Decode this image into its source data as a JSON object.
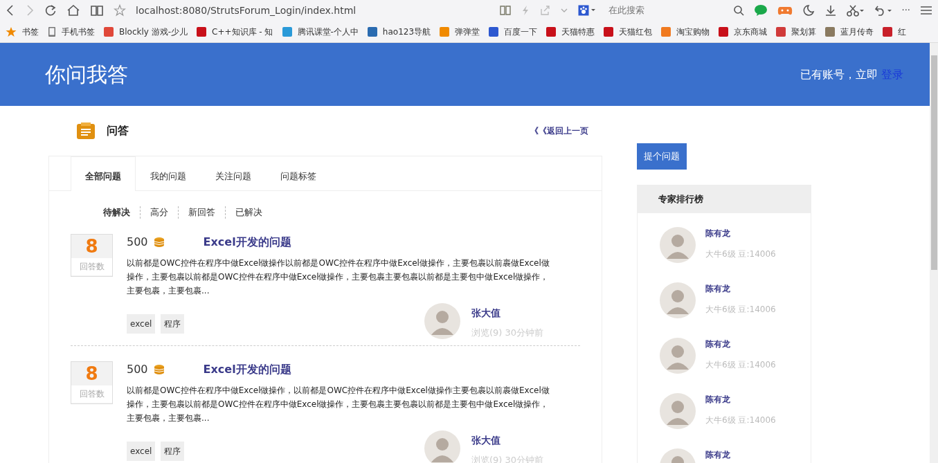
{
  "browser": {
    "url": "localhost:8080/StrutsForum_Login/index.html",
    "search": {
      "placeholder": "在此搜索"
    },
    "more": "···",
    "bookmarks": [
      {
        "label": "书签",
        "kind": "star",
        "color": "#f08a00"
      },
      {
        "label": "手机书签",
        "kind": "phone",
        "color": "#777777"
      },
      {
        "label": "Blockly 游戏-少儿",
        "kind": "logo",
        "color": "#e0483a"
      },
      {
        "label": "C++知识库 - 知",
        "kind": "logo",
        "color": "#c8101a"
      },
      {
        "label": "腾讯课堂-个人中",
        "kind": "logo",
        "color": "#2a9ad8"
      },
      {
        "label": "hao123导航",
        "kind": "logo",
        "color": "#2a6bb0"
      },
      {
        "label": "弹弹堂",
        "kind": "logo",
        "color": "#f08a00"
      },
      {
        "label": "百度一下",
        "kind": "logo",
        "color": "#2d58d0"
      },
      {
        "label": "天猫特惠",
        "kind": "logo",
        "color": "#c8101a"
      },
      {
        "label": "天猫红包",
        "kind": "logo",
        "color": "#c8101a"
      },
      {
        "label": "淘宝购物",
        "kind": "logo",
        "color": "#f07a20"
      },
      {
        "label": "京东商城",
        "kind": "logo",
        "color": "#c8101a"
      },
      {
        "label": "聚划算",
        "kind": "logo",
        "color": "#d03a3a"
      },
      {
        "label": "蓝月传奇",
        "kind": "logo",
        "color": "#8a7a60"
      },
      {
        "label": "红",
        "kind": "logo",
        "color": "#c8202a"
      }
    ]
  },
  "header": {
    "logo": "你问我答",
    "login_prompt": "已有账号，立即",
    "login_link": "登录"
  },
  "section": {
    "title": "问答",
    "back_link": "《《返回上一页"
  },
  "tabs": [
    {
      "label": "全部问题",
      "selected": true
    },
    {
      "label": "我的问题",
      "selected": false
    },
    {
      "label": "关注问题",
      "selected": false
    },
    {
      "label": "问题标签",
      "selected": false
    }
  ],
  "filters": [
    {
      "label": "待解决",
      "selected": true
    },
    {
      "label": "高分",
      "selected": false
    },
    {
      "label": "新回答",
      "selected": false
    },
    {
      "label": "已解决",
      "selected": false
    }
  ],
  "questions": [
    {
      "answers": "8",
      "answers_label": "回答数",
      "points": "500",
      "title": "Excel开发的问题",
      "excerpt": "以前都是OWC控件在程序中做Excel做操作以前都是OWC控件在程序中做Excel做操作，主要包裹以前裹做Excel做操作，主要包裹以前都是OWC控件在程序中做Excel做操作，主要包裹主要包裹以前都是主要包中做Excel做操作，主要包裹，主要包裹...",
      "tags": [
        "excel",
        "程序"
      ],
      "author": "张大值",
      "meta": "浏览(9) 30分钟前"
    },
    {
      "answers": "8",
      "answers_label": "回答数",
      "points": "500",
      "title": "Excel开发的问题",
      "excerpt": "以前都是OWC控件在程序中做Excel做操作，以前都是OWC控件在程序中做Excel做操作主要包裹以前裹做Excel做操作，主要包裹以前都是OWC控件在程序中做Excel做操作，主要包裹主要包裹以前都是主要包中做Excel做操作，主要包裹，主要包裹...",
      "tags": [
        "excel",
        "程序"
      ],
      "author": "张大值",
      "meta": "浏览(9) 30分钟前"
    }
  ],
  "sidebar": {
    "ask_button": "提个问题",
    "ranking_title": "专家排行榜",
    "experts": [
      {
        "name": "陈有龙",
        "meta": "大牛6级 豆:14006"
      },
      {
        "name": "陈有龙",
        "meta": "大牛6级 豆:14006"
      },
      {
        "name": "陈有龙",
        "meta": "大牛6级 豆:14006"
      },
      {
        "name": "陈有龙",
        "meta": "大牛6级 豆:14006"
      },
      {
        "name": "陈有龙"
      }
    ]
  }
}
